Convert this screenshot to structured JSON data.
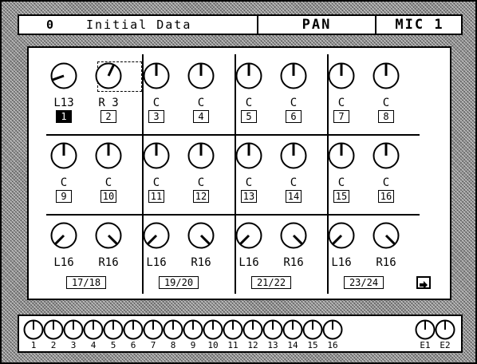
{
  "header": {
    "scene_number": "0",
    "scene_name": "Initial Data",
    "function": "PAN",
    "source": "MIC 1"
  },
  "rows": [
    {
      "knobs": [
        {
          "label": "L13",
          "pan": -13
        },
        {
          "label": "R 3",
          "pan": 3
        },
        {
          "label": "C",
          "pan": 0
        },
        {
          "label": "C",
          "pan": 0
        },
        {
          "label": "C",
          "pan": 0
        },
        {
          "label": "C",
          "pan": 0
        },
        {
          "label": "C",
          "pan": 0
        },
        {
          "label": "C",
          "pan": 0
        }
      ],
      "channels": [
        "1",
        "2",
        "3",
        "4",
        "5",
        "6",
        "7",
        "8"
      ],
      "selected_channel": "1"
    },
    {
      "knobs": [
        {
          "label": "C",
          "pan": 0
        },
        {
          "label": "C",
          "pan": 0
        },
        {
          "label": "C",
          "pan": 0
        },
        {
          "label": "C",
          "pan": 0
        },
        {
          "label": "C",
          "pan": 0
        },
        {
          "label": "C",
          "pan": 0
        },
        {
          "label": "C",
          "pan": 0
        },
        {
          "label": "C",
          "pan": 0
        }
      ],
      "channels": [
        "9",
        "10",
        "11",
        "12",
        "13",
        "14",
        "15",
        "16"
      ]
    },
    {
      "knobs": [
        {
          "label": "L16",
          "pan": -16
        },
        {
          "label": "R16",
          "pan": 16
        },
        {
          "label": "L16",
          "pan": -16
        },
        {
          "label": "R16",
          "pan": 16
        },
        {
          "label": "L16",
          "pan": -16
        },
        {
          "label": "R16",
          "pan": 16
        },
        {
          "label": "L16",
          "pan": -16
        },
        {
          "label": "R16",
          "pan": 16
        }
      ],
      "pairs": [
        "17/18",
        "19/20",
        "21/22",
        "23/24"
      ]
    }
  ],
  "next_page_icon": "arrow-right-icon",
  "mini_knobs": [
    "1",
    "2",
    "3",
    "4",
    "5",
    "6",
    "7",
    "8",
    "9",
    "10",
    "11",
    "12",
    "13",
    "14",
    "15",
    "16",
    "E1",
    "E2"
  ]
}
